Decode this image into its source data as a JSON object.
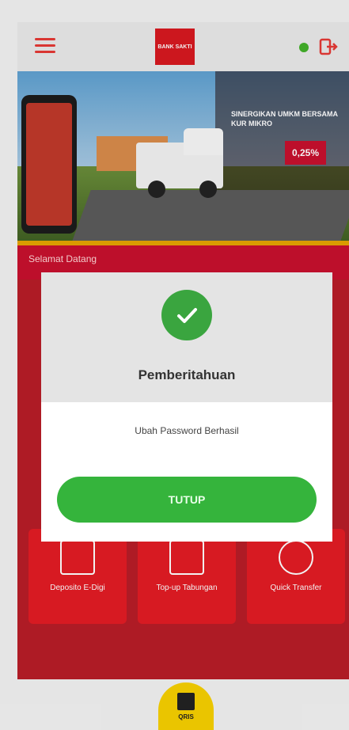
{
  "header": {
    "logo_text": "BANK\nSAKTI",
    "online_status_color": "#43b02a",
    "logout_icon": "logout-icon",
    "menu_icon": "hamburger-menu-icon"
  },
  "banner": {
    "headline": "SINERGIKAN UMKM BERSAMA KUR MIKRO",
    "rate": "0,25%"
  },
  "dashboard": {
    "welcome": "Selamat Datang",
    "tiles": [
      {
        "label": "Deposito E-Digi",
        "icon": "deposit-icon"
      },
      {
        "label": "Top-up Tabungan",
        "icon": "topup-icon"
      },
      {
        "label": "Quick Transfer",
        "icon": "transfer-icon"
      }
    ]
  },
  "bottom_nav": {
    "qris_label": "QRIS",
    "qris_icon": "qr-code-icon"
  },
  "modal": {
    "title": "Pemberitahuan",
    "message": "Ubah Password Berhasil",
    "button_label": "TUTUP",
    "icon": "check-circle-icon",
    "accent_color": "#35b43c"
  }
}
